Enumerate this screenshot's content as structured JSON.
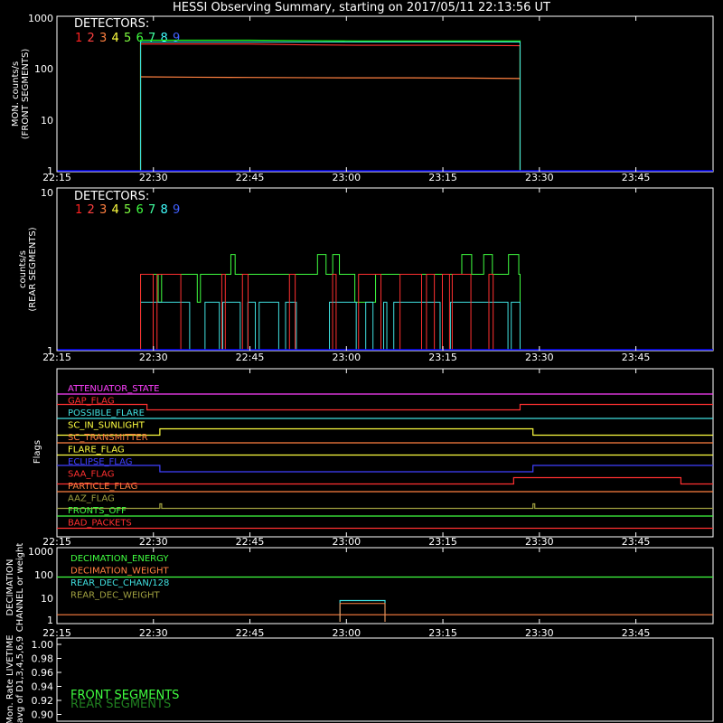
{
  "title": "HESSI Observing Summary, starting on 2017/05/11 22:13:56 UT",
  "colors": {
    "det": [
      "#ff2020",
      "#ff4040",
      "#ff8040",
      "#ffff40",
      "#80ff40",
      "#40ff40",
      "#40ffa0",
      "#40ffff",
      "#4060ff"
    ],
    "front_flux_red": "#ff3030",
    "front_flux_green": "#20ff20",
    "front_flux_cyan": "#40e0e0",
    "front_flux_orange": "#ff8040",
    "baseline_blue": "#0000ff"
  },
  "time_ticks": [
    "22:15",
    "22:30",
    "22:45",
    "23:00",
    "23:15",
    "23:30",
    "23:45"
  ],
  "panel1": {
    "ylabel": "MON. counts/s",
    "ylabel2": "(FRONT SEGMENTS)",
    "yticks": [
      "1000",
      "100",
      "10",
      "1"
    ],
    "detectors_label": "DETECTORS:",
    "detector_numbers": [
      "1",
      "2",
      "3",
      "4",
      "5",
      "6",
      "7",
      "8",
      "9"
    ],
    "chart_data": {
      "type": "line",
      "x_start": "22:28",
      "x_end": "23:27",
      "series": [
        {
          "values": [
            500,
            500,
            500,
            480,
            470,
            470,
            470,
            460
          ]
        },
        {
          "values": [
            600,
            600,
            600,
            590,
            580,
            580,
            580,
            580
          ]
        },
        {
          "values": [
            100,
            98,
            97,
            96,
            95,
            95,
            94,
            92
          ]
        }
      ]
    }
  },
  "panel2": {
    "ylabel": "counts/s",
    "ylabel2": "(REAR SEGMENTS)",
    "yticks": [
      "10",
      "1"
    ],
    "detectors_label": "DETECTORS:",
    "detector_numbers": [
      "1",
      "2",
      "3",
      "4",
      "5",
      "6",
      "7",
      "8",
      "9"
    ],
    "chart_data": {
      "type": "line",
      "x_start": "22:28",
      "x_end": "23:27",
      "values_level": [
        3,
        2
      ]
    }
  },
  "panel3": {
    "ylabel": "Flags",
    "flags": [
      {
        "name": "ATTENUATOR_STATE",
        "color": "#ff40ff"
      },
      {
        "name": "GAP_FLAG",
        "color": "#ff3030"
      },
      {
        "name": "POSSIBLE_FLARE",
        "color": "#40e0e0"
      },
      {
        "name": "SC_IN_SUNLIGHT",
        "color": "#ffff40"
      },
      {
        "name": "SC_TRANSMITTER",
        "color": "#ff8040"
      },
      {
        "name": "FLARE_FLAG",
        "color": "#ffff40"
      },
      {
        "name": "ECLIPSE_FLAG",
        "color": "#4040ff"
      },
      {
        "name": "SAA_FLAG",
        "color": "#ff3030"
      },
      {
        "name": "PARTICLE_FLAG",
        "color": "#ff8040"
      },
      {
        "name": "AAZ_FLAG",
        "color": "#a0a040"
      },
      {
        "name": "FRONTS_OFF",
        "color": "#40ff40"
      },
      {
        "name": "BAD_PACKETS",
        "color": "#ff3030"
      }
    ]
  },
  "panel4": {
    "ylabel": "DECIMATION",
    "ylabel2": "CHANNEL or weight",
    "yticks": [
      "1000",
      "100",
      "10",
      "1"
    ],
    "legend": [
      {
        "name": "DECIMATION_ENERGY",
        "color": "#40ff40"
      },
      {
        "name": "DECIMATION_WEIGHT",
        "color": "#ff8040"
      },
      {
        "name": "REAR_DEC_CHAN/128",
        "color": "#40e0e0"
      },
      {
        "name": "REAR_DEC_WEIGHT",
        "color": "#a0a040"
      }
    ],
    "chart_data": {
      "type": "line",
      "series": [
        {
          "name": "DECIMATION_ENERGY",
          "values": [
            80
          ]
        },
        {
          "name": "DECIMATION_WEIGHT",
          "values": [
            2
          ]
        },
        {
          "name": "REAR_DEC_CHAN/128",
          "values": [
            8
          ]
        },
        {
          "name": "REAR_DEC_WEIGHT",
          "values": [
            1
          ]
        }
      ]
    }
  },
  "panel5": {
    "ylabel": "Mon. Rate LIVETIME",
    "ylabel2": "avg of D1,3,4,5,6,9",
    "yticks": [
      "1.00",
      "0.98",
      "0.96",
      "0.94",
      "0.92",
      "0.90"
    ],
    "legend": [
      {
        "name": "FRONT SEGMENTS",
        "color": "#40ff40"
      },
      {
        "name": "REAR SEGMENTS",
        "color": "#208020"
      }
    ]
  }
}
